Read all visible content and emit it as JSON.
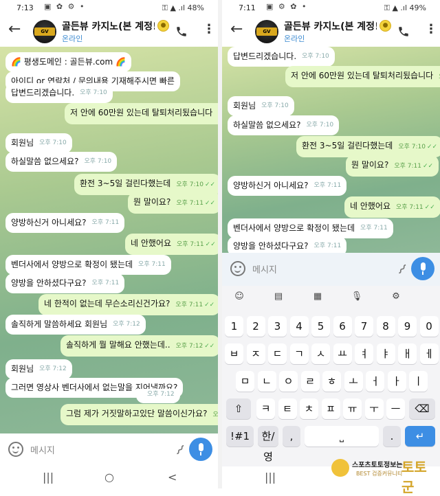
{
  "left": {
    "status": {
      "time": "7:13",
      "icons": "▣ ✿ ⚙ •",
      "right": "⚿ ▲ .ıl 48%"
    },
    "header": {
      "back": "←",
      "name": "골든뷰 카지노(본 계정!",
      "status": "온라인",
      "more": "⋮"
    },
    "messages": [
      {
        "dir": "in",
        "text": "🌈 평생도메인 : 골든뷰.com 🌈",
        "time": ""
      },
      {
        "dir": "in",
        "text": "아이디 or 연락처 / 문의내용 기재해주시면 빠른",
        "time": ""
      },
      {
        "dir": "in",
        "text": "답변드리겠습니다.",
        "time": "오후 7:10"
      },
      {
        "dir": "out",
        "text": "저 안에 60만원 있는데 탈퇴처리됬습니다",
        "time": "오후 7:10"
      },
      {
        "dir": "in",
        "text": "회원님",
        "time": "오후 7:10"
      },
      {
        "dir": "in",
        "text": "하실말씀 없으세요?",
        "time": "오후 7:10"
      },
      {
        "dir": "out",
        "text": "환전 3~5일 걸린다했는데",
        "time": "오후 7:10"
      },
      {
        "dir": "out",
        "text": "뭔 말이요?",
        "time": "오후 7:11"
      },
      {
        "dir": "in",
        "text": "양방하신거 아니세요?",
        "time": "오후 7:11"
      },
      {
        "dir": "out",
        "text": "네 안했어요",
        "time": "오후 7:11"
      },
      {
        "dir": "in",
        "text": "벤더사에서 양방으로 확정이 됐는데",
        "time": "오후 7:11"
      },
      {
        "dir": "in",
        "text": "양방을 안하셨다구요?",
        "time": "오후 7:11"
      },
      {
        "dir": "out",
        "text": "네 한적이 없는데 무슨소리신건가요?",
        "time": "오후 7:11"
      },
      {
        "dir": "in",
        "text": "솔직하게 말씀하세요 회원님",
        "time": "오후 7:12"
      },
      {
        "dir": "out",
        "text": "솔직하게 뭘 말해요 안했는데..",
        "time": "오후 7:12"
      },
      {
        "dir": "in",
        "text": "회원님",
        "time": "오후 7:12"
      },
      {
        "dir": "in",
        "text": "그러면 영상사 벤더사에서 없는말을 지어낼까요?",
        "time": ""
      },
      {
        "dir": "in",
        "text": "",
        "time": "오후 7:12"
      },
      {
        "dir": "out",
        "text": "그럼 제가 거짓말하고있단 말씀이신가요?",
        "time": "오후 7:13"
      }
    ],
    "input_placeholder": "메시지",
    "nav": [
      "|||",
      "○",
      "<"
    ]
  },
  "right": {
    "status": {
      "time": "7:11",
      "icons": "▣ ⚙ ✿ •",
      "right": "⚿ ▲ .ıl 49%"
    },
    "header": {
      "back": "←",
      "name": "골든뷰 카지노(본 계정!",
      "status": "온라인",
      "more": "⋮"
    },
    "messages": [
      {
        "dir": "in",
        "text": "답변드리겠습니다.",
        "time": "오후 7:10"
      },
      {
        "dir": "out",
        "text": "저 안에 60만원 있는데 탈퇴처리됬습니다",
        "time": "오후 7:10"
      },
      {
        "dir": "in",
        "text": "회원님",
        "time": "오후 7:10"
      },
      {
        "dir": "in",
        "text": "하실말씀 없으세요?",
        "time": "오후 7:10"
      },
      {
        "dir": "out",
        "text": "환전 3~5일 걸린다했는데",
        "time": "오후 7:10"
      },
      {
        "dir": "out",
        "text": "뭔 말이요?",
        "time": "오후 7:11"
      },
      {
        "dir": "in",
        "text": "양방하신거 아니세요?",
        "time": "오후 7:11"
      },
      {
        "dir": "out",
        "text": "네 안했어요",
        "time": "오후 7:11"
      },
      {
        "dir": "in",
        "text": "벤더사에서 양방으로 확정이 됐는데",
        "time": "오후 7:11"
      },
      {
        "dir": "in",
        "text": "양방을 안하셨다구요?",
        "time": "오후 7:11"
      }
    ],
    "input_placeholder": "메시지",
    "keyboard": {
      "toolbar": [
        "☺",
        "▤",
        "▦",
        "🎙",
        "⚙"
      ],
      "row_numbers": [
        "1",
        "2",
        "3",
        "4",
        "5",
        "6",
        "7",
        "8",
        "9",
        "0"
      ],
      "row1": [
        "ㅂ",
        "ㅈ",
        "ㄷ",
        "ㄱ",
        "ㅅ",
        "ㅛ",
        "ㅕ",
        "ㅑ",
        "ㅐ",
        "ㅔ"
      ],
      "row2": [
        "ㅁ",
        "ㄴ",
        "ㅇ",
        "ㄹ",
        "ㅎ",
        "ㅗ",
        "ㅓ",
        "ㅏ",
        "ㅣ"
      ],
      "row3": [
        "ㅋ",
        "ㅌ",
        "ㅊ",
        "ㅍ",
        "ㅠ",
        "ㅜ",
        "ㅡ"
      ],
      "shift": "⇧",
      "backspace": "⌫",
      "sym": "!#1",
      "lang": "한/영",
      "comma": ",",
      "space": "⎵",
      "period": ".",
      "enter": "↵"
    },
    "nav": [
      "|||"
    ]
  },
  "watermark": {
    "line1": "스포츠토토정보는",
    "line2": "BEST 검증커뮤니티",
    "brand": "토토군"
  },
  "colors": {
    "accent": "#3d8ee4",
    "bubble_out": "#e6f8c9",
    "bubble_in": "#ffffff"
  }
}
